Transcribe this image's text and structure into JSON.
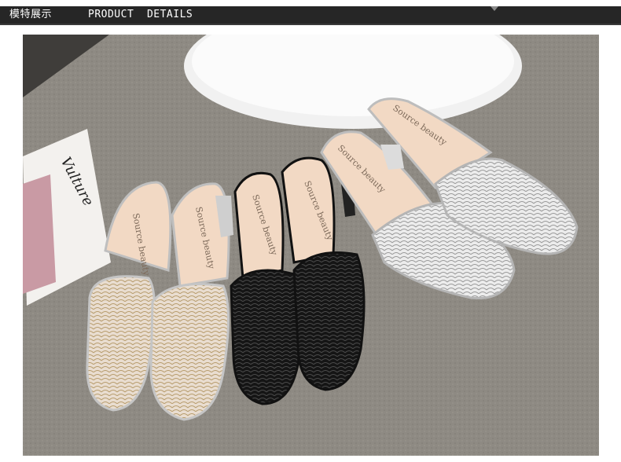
{
  "header": {
    "title": "模特展示",
    "subtitle": "PRODUCT  DETAILS"
  },
  "photo": {
    "magazine_text": "Vulture",
    "insole_brand": "Source beauty"
  },
  "colors": {
    "header_bg": "#262626",
    "carpet": "#8f8b84",
    "gold_mesh": "#d9cbb8",
    "black_mesh": "#1c1c1c",
    "silver_mesh": "#dcdcdc",
    "insole": "#f2d8c3"
  }
}
